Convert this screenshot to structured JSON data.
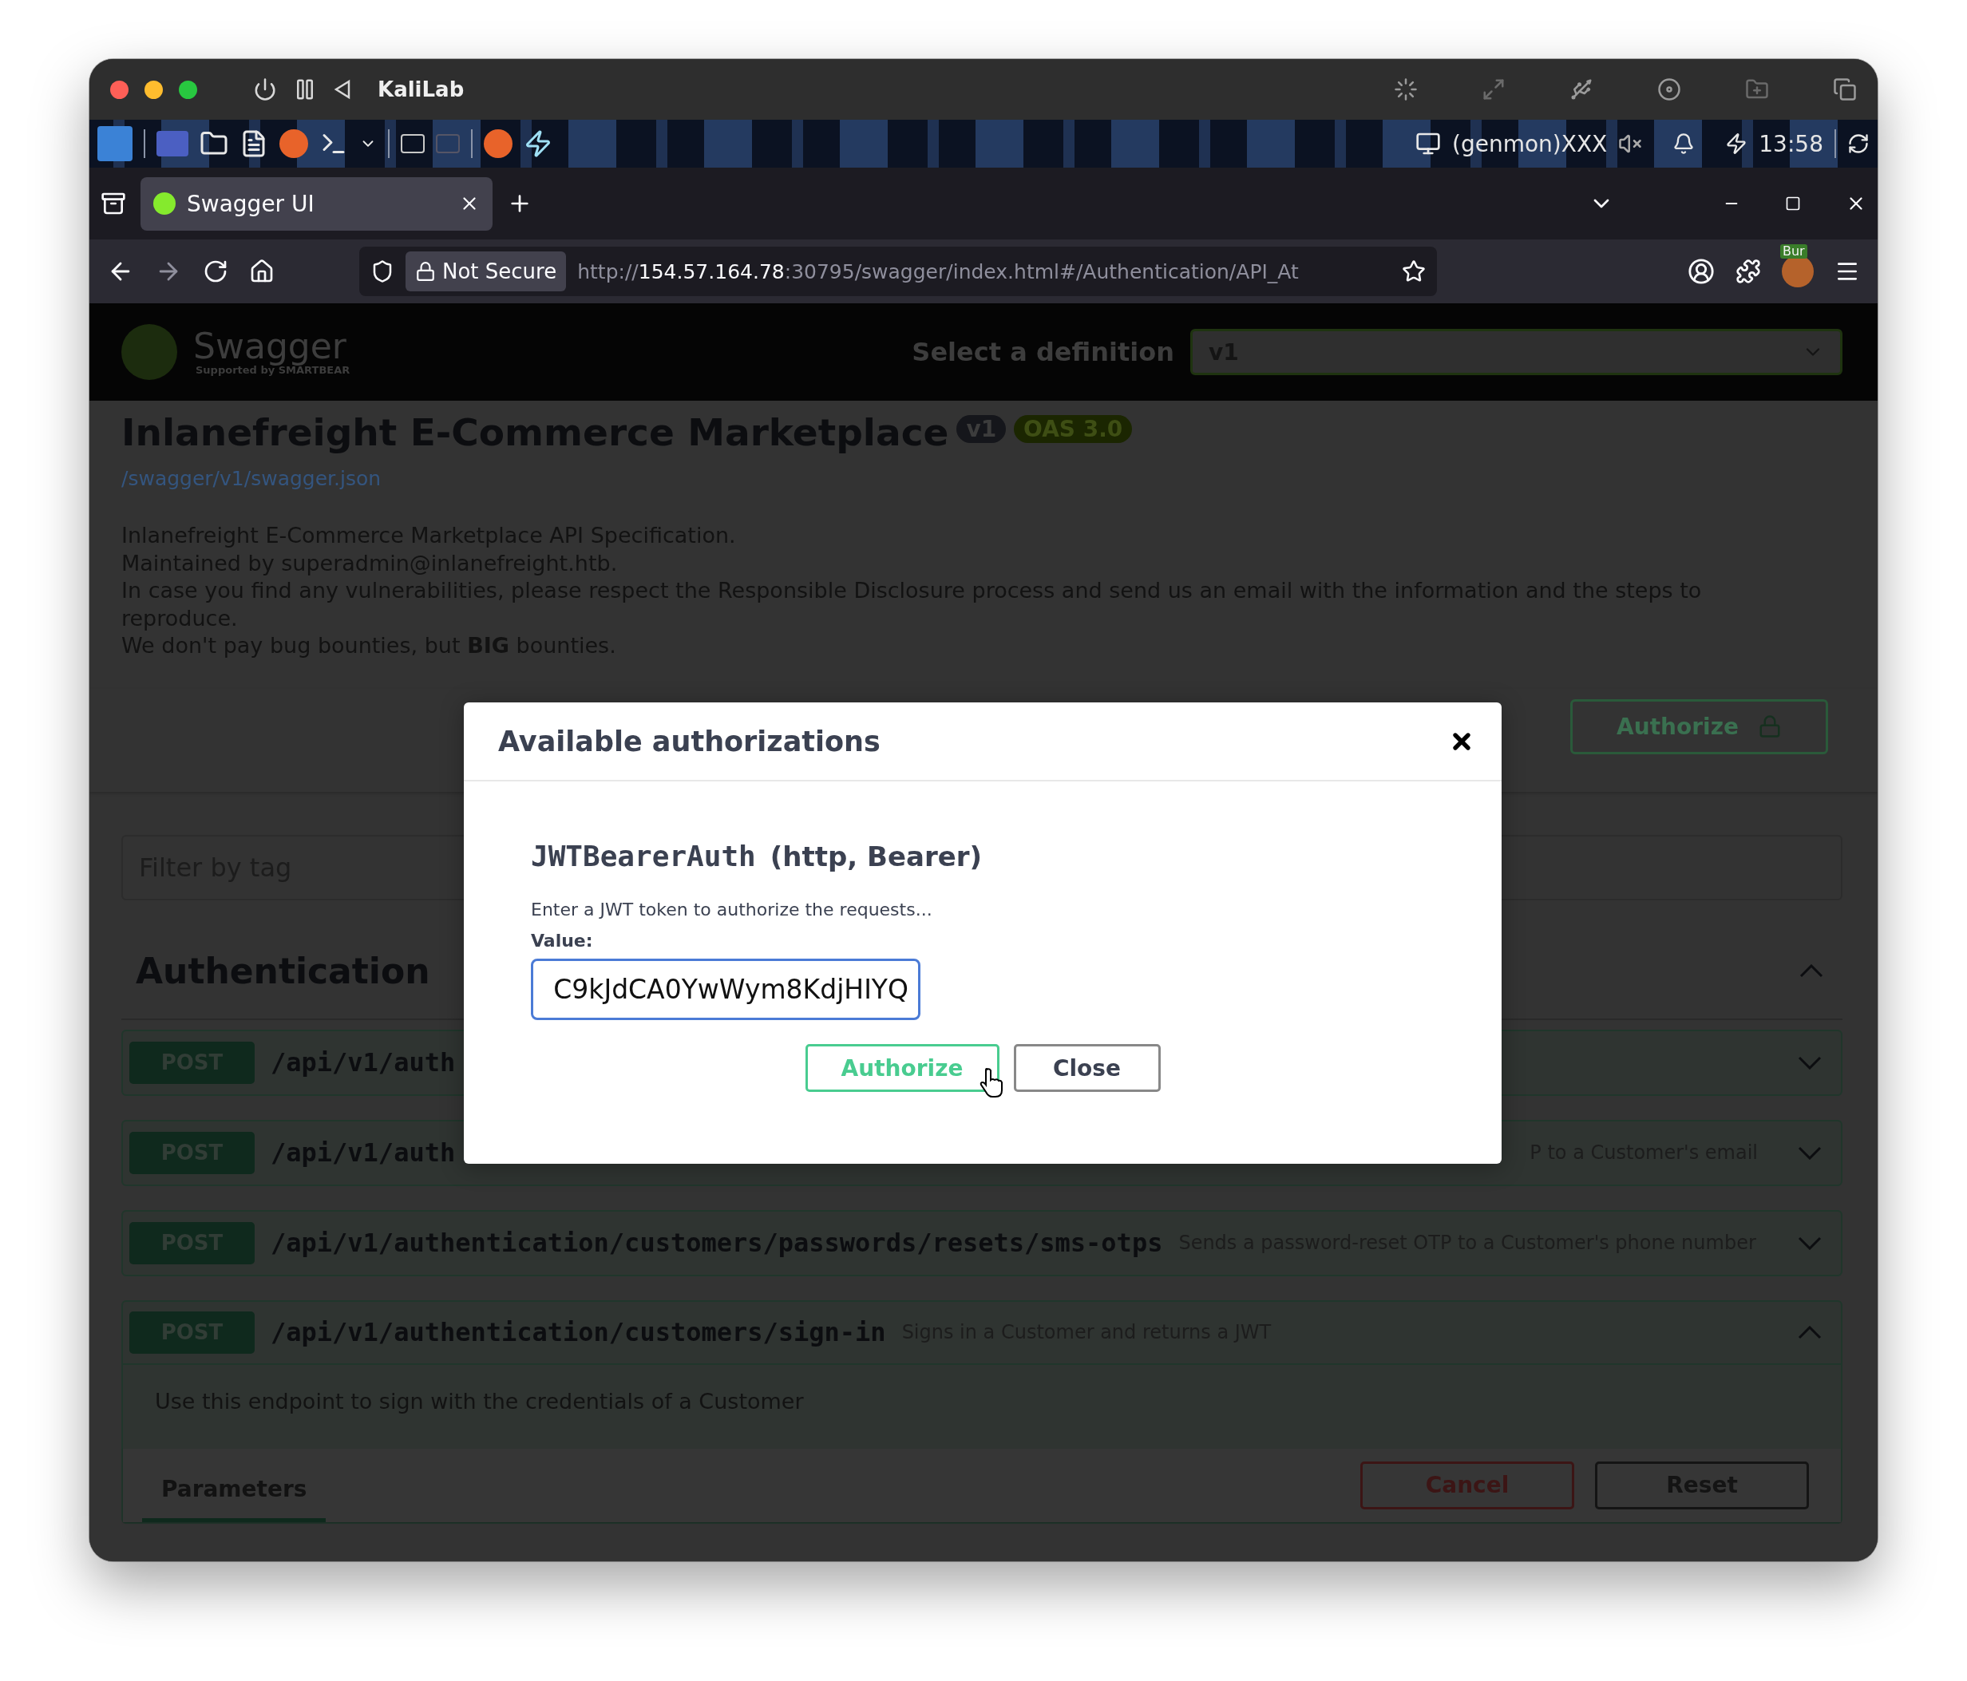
{
  "vm_window": {
    "title": "KaliLab"
  },
  "panel": {
    "genmon": "(genmon)XXX",
    "clock": "13:58"
  },
  "browser": {
    "tabs": [
      {
        "title": "Swagger UI",
        "selected": true
      }
    ],
    "address": {
      "security": "Not Secure",
      "url_scheme": "http://",
      "url_host": "154.57.164.78",
      "url_rest": ":30795/swagger/index.html#/Authentication/API_At"
    },
    "extension_badge": "Bur"
  },
  "swagger": {
    "logo_text": "Swagger",
    "logo_tagline": "Supported by SMARTBEAR",
    "definition_label": "Select a definition",
    "definition": "v1",
    "title": "Inlanefreight E-Commerce Marketplace",
    "version_badge": "v1",
    "oas_badge": "OAS 3.0",
    "spec_link": "/swagger/v1/swagger.json",
    "description": [
      "Inlanefreight E-Commerce Marketplace API Specification.",
      "Maintained by superadmin@inlanefreight.htb.",
      "In case you find any vulnerabilities, please respect the Responsible Disclosure process and send us an email with the information and the steps to reproduce.",
      "We don't pay bug bounties, but **BIG** bounties."
    ],
    "authorize_button": "Authorize",
    "filter": {
      "placeholder": "Filter by tag"
    },
    "section": {
      "title": "Authentication",
      "expanded": true
    },
    "operations": [
      {
        "method": "POST",
        "path": "/api/v1/auth",
        "expanded": false
      },
      {
        "method": "POST",
        "path": "/api/v1/auth",
        "summary_tail": "P to a Customer's email",
        "expanded": false
      },
      {
        "method": "POST",
        "path": "/api/v1/authentication/customers/passwords/resets/sms-otps",
        "summary": "Sends a password-reset OTP to a Customer's phone number",
        "expanded": false
      },
      {
        "method": "POST",
        "path": "/api/v1/authentication/customers/sign-in",
        "summary": "Signs in a Customer and returns a JWT",
        "expanded": true,
        "description": "Use this endpoint to sign with the credentials of a Customer",
        "tabs": [
          {
            "label": "Parameters",
            "selected": true
          }
        ],
        "buttons": [
          {
            "label": "Cancel",
            "kind": "cancel"
          },
          {
            "label": "Reset",
            "kind": "reset"
          }
        ]
      }
    ]
  },
  "modal": {
    "title": "Available authorizations",
    "scheme": "JWTBearerAuth",
    "scheme_info": "(http, Bearer)",
    "hint": "Enter a JWT token to authorize the requests...",
    "value_label": "Value:",
    "value": "C9kJdCA0YwWym8KdjHIYQ",
    "buttons": [
      {
        "label": "Authorize",
        "kind": "primary"
      },
      {
        "label": "Close",
        "kind": "secondary"
      }
    ]
  }
}
